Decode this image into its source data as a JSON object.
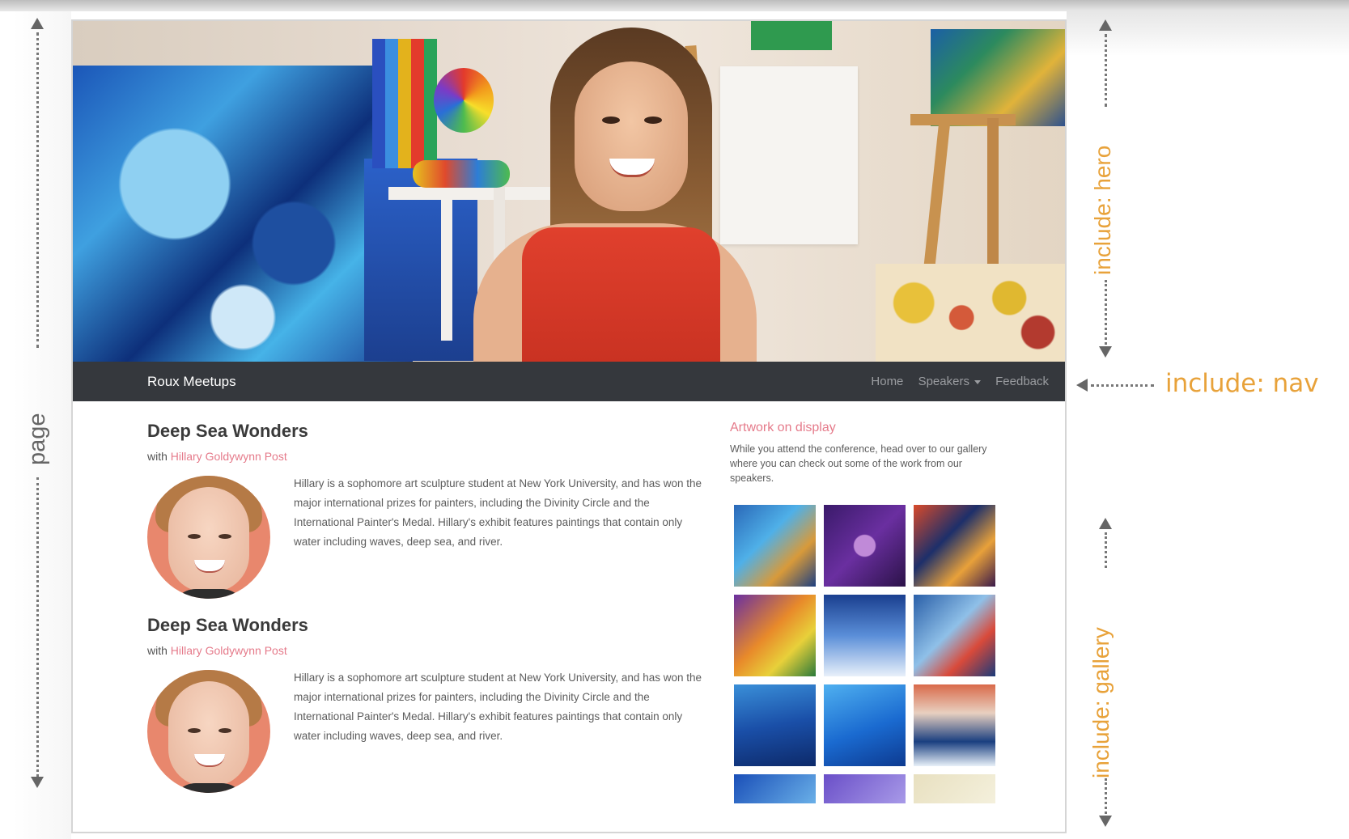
{
  "nav": {
    "brand": "Roux Meetups",
    "links": [
      "Home",
      "Speakers",
      "Feedback"
    ]
  },
  "sessions": [
    {
      "title": "Deep Sea Wonders",
      "with_label": "with",
      "speaker": "Hillary Goldywynn Post",
      "body": "Hillary is a sophomore art sculpture student at New York University, and has won the major international prizes for painters, including the Divinity Circle and the International Painter's Medal. Hillary's exhibit features paintings that contain only water including waves, deep sea, and river."
    },
    {
      "title": "Deep Sea Wonders",
      "with_label": "with",
      "speaker": "Hillary Goldywynn Post",
      "body": "Hillary is a sophomore art sculpture student at New York University, and has won the major international prizes for painters, including the Divinity Circle and the International Painter's Medal. Hillary's exhibit features paintings that contain only water including waves, deep sea, and river."
    }
  ],
  "sidebar": {
    "title": "Artwork on display",
    "description": "While you attend the conference, head over to our gallery where you can check out some of the work from our speakers."
  },
  "annotations": {
    "page": "page",
    "hero": "include: hero",
    "nav": "include: nav",
    "gallery": "include: gallery"
  },
  "colors": {
    "accent": "#e57a8a",
    "navbar": "#35383d",
    "annotation": "#e8a23a"
  },
  "icons": {
    "dropdown": "caret-down-icon"
  }
}
